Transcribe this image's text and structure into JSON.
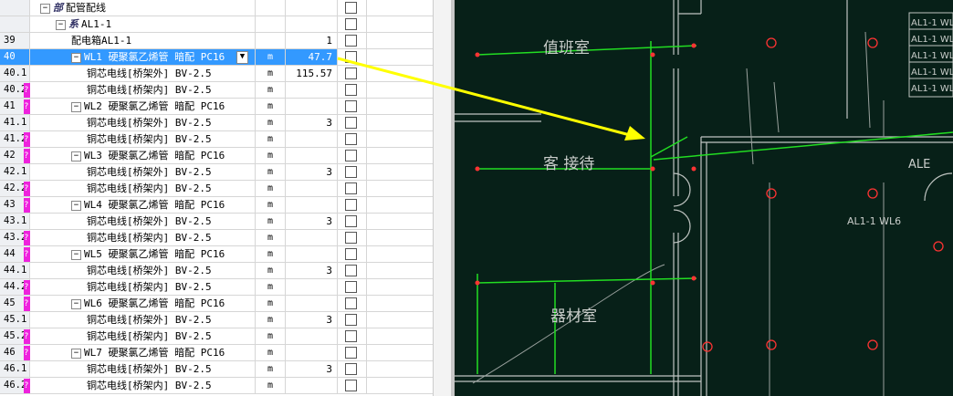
{
  "grid": {
    "rows": [
      {
        "num": "",
        "name": "配管配线",
        "tag": "部",
        "unit": "",
        "qty": "",
        "indent": 1,
        "expander": "⊟",
        "pink": false,
        "selected": false
      },
      {
        "num": "",
        "name": "AL1-1",
        "tag": "系",
        "unit": "",
        "qty": "",
        "indent": 2,
        "expander": "⊟",
        "pink": false,
        "selected": false
      },
      {
        "num": "39",
        "name": "配电箱AL1-1",
        "tag": "",
        "unit": "",
        "qty": "1",
        "indent": 3,
        "expander": "",
        "pink": false,
        "selected": false
      },
      {
        "num": "40",
        "name": "WL1 硬聚氯乙烯管 暗配 PC16",
        "tag": "",
        "unit": "m",
        "qty": "47.7",
        "indent": 3,
        "expander": "⊟",
        "pink": false,
        "selected": true
      },
      {
        "num": "40.1",
        "name": "铜芯电线[桥架外] BV-2.5",
        "tag": "",
        "unit": "m",
        "qty": "115.57",
        "indent": 4,
        "expander": "",
        "pink": false,
        "selected": false
      },
      {
        "num": "40.2",
        "name": "铜芯电线[桥架内] BV-2.5",
        "tag": "",
        "unit": "m",
        "qty": "",
        "indent": 4,
        "expander": "",
        "pink": true,
        "selected": false
      },
      {
        "num": "41",
        "name": "WL2 硬聚氯乙烯管 暗配 PC16",
        "tag": "",
        "unit": "m",
        "qty": "",
        "indent": 3,
        "expander": "⊟",
        "pink": true,
        "selected": false
      },
      {
        "num": "41.1",
        "name": "铜芯电线[桥架外] BV-2.5",
        "tag": "",
        "unit": "m",
        "qty": "3",
        "indent": 4,
        "expander": "",
        "pink": false,
        "selected": false
      },
      {
        "num": "41.2",
        "name": "铜芯电线[桥架内] BV-2.5",
        "tag": "",
        "unit": "m",
        "qty": "",
        "indent": 4,
        "expander": "",
        "pink": true,
        "selected": false
      },
      {
        "num": "42",
        "name": "WL3 硬聚氯乙烯管 暗配 PC16",
        "tag": "",
        "unit": "m",
        "qty": "",
        "indent": 3,
        "expander": "⊟",
        "pink": true,
        "selected": false
      },
      {
        "num": "42.1",
        "name": "铜芯电线[桥架外] BV-2.5",
        "tag": "",
        "unit": "m",
        "qty": "3",
        "indent": 4,
        "expander": "",
        "pink": false,
        "selected": false
      },
      {
        "num": "42.2",
        "name": "铜芯电线[桥架内] BV-2.5",
        "tag": "",
        "unit": "m",
        "qty": "",
        "indent": 4,
        "expander": "",
        "pink": true,
        "selected": false
      },
      {
        "num": "43",
        "name": "WL4 硬聚氯乙烯管 暗配 PC16",
        "tag": "",
        "unit": "m",
        "qty": "",
        "indent": 3,
        "expander": "⊟",
        "pink": true,
        "selected": false
      },
      {
        "num": "43.1",
        "name": "铜芯电线[桥架外] BV-2.5",
        "tag": "",
        "unit": "m",
        "qty": "3",
        "indent": 4,
        "expander": "",
        "pink": false,
        "selected": false
      },
      {
        "num": "43.2",
        "name": "铜芯电线[桥架内] BV-2.5",
        "tag": "",
        "unit": "m",
        "qty": "",
        "indent": 4,
        "expander": "",
        "pink": true,
        "selected": false
      },
      {
        "num": "44",
        "name": "WL5 硬聚氯乙烯管 暗配 PC16",
        "tag": "",
        "unit": "m",
        "qty": "",
        "indent": 3,
        "expander": "⊟",
        "pink": true,
        "selected": false
      },
      {
        "num": "44.1",
        "name": "铜芯电线[桥架外] BV-2.5",
        "tag": "",
        "unit": "m",
        "qty": "3",
        "indent": 4,
        "expander": "",
        "pink": false,
        "selected": false
      },
      {
        "num": "44.2",
        "name": "铜芯电线[桥架内] BV-2.5",
        "tag": "",
        "unit": "m",
        "qty": "",
        "indent": 4,
        "expander": "",
        "pink": true,
        "selected": false
      },
      {
        "num": "45",
        "name": "WL6 硬聚氯乙烯管 暗配 PC16",
        "tag": "",
        "unit": "m",
        "qty": "",
        "indent": 3,
        "expander": "⊟",
        "pink": true,
        "selected": false
      },
      {
        "num": "45.1",
        "name": "铜芯电线[桥架外] BV-2.5",
        "tag": "",
        "unit": "m",
        "qty": "3",
        "indent": 4,
        "expander": "",
        "pink": false,
        "selected": false
      },
      {
        "num": "45.2",
        "name": "铜芯电线[桥架内] BV-2.5",
        "tag": "",
        "unit": "m",
        "qty": "",
        "indent": 4,
        "expander": "",
        "pink": true,
        "selected": false
      },
      {
        "num": "46",
        "name": "WL7 硬聚氯乙烯管 暗配 PC16",
        "tag": "",
        "unit": "m",
        "qty": "",
        "indent": 3,
        "expander": "⊟",
        "pink": true,
        "selected": false
      },
      {
        "num": "46.1",
        "name": "铜芯电线[桥架外] BV-2.5",
        "tag": "",
        "unit": "m",
        "qty": "3",
        "indent": 4,
        "expander": "",
        "pink": false,
        "selected": false
      },
      {
        "num": "46.2",
        "name": "铜芯电线[桥架内] BV-2.5",
        "tag": "",
        "unit": "m",
        "qty": "",
        "indent": 4,
        "expander": "",
        "pink": true,
        "selected": false
      }
    ]
  },
  "cad": {
    "rooms": {
      "duty": "值班室",
      "reception": "客 接待",
      "equipment": "器材室"
    },
    "labels": {
      "ale": "ALE",
      "circuit": "AL1-1 WL6"
    },
    "legend": [
      "AL1-1 WL",
      "AL1-1 WL",
      "AL1-1 WL",
      "AL1-1 WL",
      "AL1-1 WL"
    ]
  },
  "colors": {
    "selected": "#3399ff",
    "pink": "#ee22dd",
    "cad_bg": "#072018",
    "wire": "#22dd22",
    "arrow": "#ffff00",
    "fixture": "#ff3333"
  }
}
